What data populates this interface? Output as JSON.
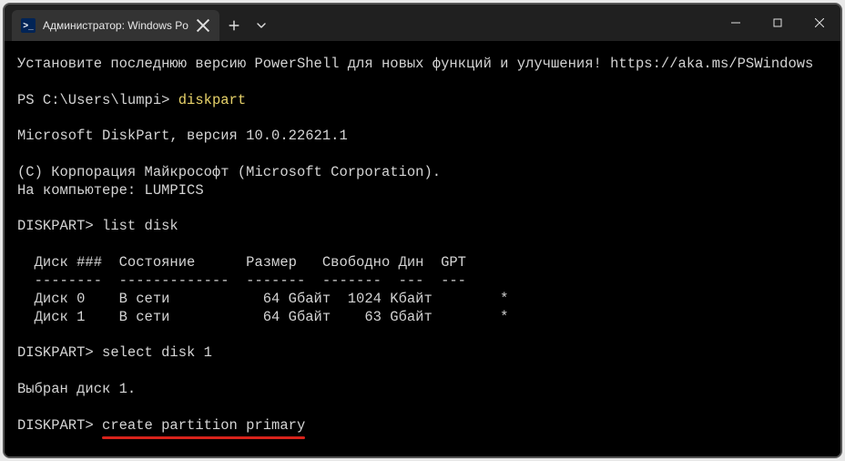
{
  "window": {
    "tab_title": "Администратор: Windows Po",
    "tab_icon_glyph": ">_"
  },
  "terminal": {
    "banner": "Установите последнюю версию PowerShell для новых функций и улучшения! https://aka.ms/PSWindows",
    "ps_prompt": "PS C:\\Users\\lumpi> ",
    "ps_cmd": "diskpart",
    "dp_version": "Microsoft DiskPart, версия 10.0.22621.1",
    "dp_copyright": "(C) Корпорация Майкрософт (Microsoft Corporation).",
    "dp_computer": "На компьютере: LUMPICS",
    "dp_prompt1": "DISKPART> ",
    "dp_cmd1": "list disk",
    "table_header": "  Диск ###  Состояние      Размер   Свободно Дин  GPT",
    "table_sep": "  --------  -------------  -------  -------  ---  ---",
    "table_row0": "  Диск 0    В сети           64 Gбайт  1024 Kбайт        *",
    "table_row1": "  Диск 1    В сети           64 Gбайт    63 Gбайт        *",
    "dp_prompt2": "DISKPART> ",
    "dp_cmd2": "select disk 1",
    "dp_select_msg": "Выбран диск 1.",
    "dp_prompt3": "DISKPART> ",
    "dp_cmd3": "create partition primary"
  },
  "chart_data": {
    "type": "table",
    "title": "list disk",
    "columns": [
      "Диск ###",
      "Состояние",
      "Размер",
      "Свободно",
      "Дин",
      "GPT"
    ],
    "rows": [
      [
        "Диск 0",
        "В сети",
        "64 Gбайт",
        "1024 Kбайт",
        "",
        "*"
      ],
      [
        "Диск 1",
        "В сети",
        "64 Gбайт",
        "63 Gбайт",
        "",
        "*"
      ]
    ]
  }
}
